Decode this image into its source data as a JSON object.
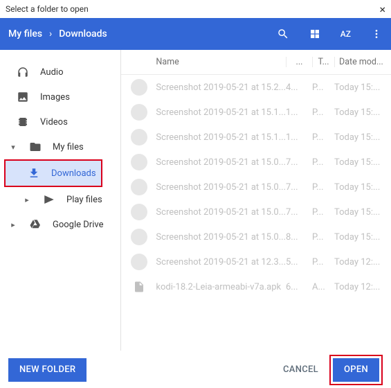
{
  "titlebar": {
    "title": "Select a folder to open"
  },
  "breadcrumb": {
    "root": "My files",
    "current": "Downloads"
  },
  "header": {
    "sort_label": "AZ"
  },
  "sidebar": {
    "audio": "Audio",
    "images": "Images",
    "videos": "Videos",
    "myfiles": "My files",
    "downloads": "Downloads",
    "playfiles": "Play files",
    "gdrive": "Google Drive"
  },
  "columns": {
    "name": "Name",
    "size": "...",
    "type": "T...",
    "date": "Date mod..."
  },
  "files": [
    {
      "name": "Screenshot 2019-05-21 at 15.2...",
      "size": "4...",
      "type": "P...",
      "date": "Today 15:..."
    },
    {
      "name": "Screenshot 2019-05-21 at 15.1...",
      "size": "1...",
      "type": "P...",
      "date": "Today 15:..."
    },
    {
      "name": "Screenshot 2019-05-21 at 15.1...",
      "size": "1...",
      "type": "P...",
      "date": "Today 15:..."
    },
    {
      "name": "Screenshot 2019-05-21 at 15.0...",
      "size": "7...",
      "type": "P...",
      "date": "Today 15:..."
    },
    {
      "name": "Screenshot 2019-05-21 at 15.0...",
      "size": "7...",
      "type": "P...",
      "date": "Today 15:..."
    },
    {
      "name": "Screenshot 2019-05-21 at 15.0...",
      "size": "7...",
      "type": "P...",
      "date": "Today 15:..."
    },
    {
      "name": "Screenshot 2019-05-21 at 15.0...",
      "size": "8...",
      "type": "P...",
      "date": "Today 15:..."
    },
    {
      "name": "Screenshot 2019-05-21 at 12.3...",
      "size": "5...",
      "type": "P...",
      "date": "Today 12:..."
    },
    {
      "name": "kodi-18.2-Leia-armeabi-v7a.apk",
      "size": "6...",
      "type": "A...",
      "date": "Today 12:...",
      "isfile": true
    }
  ],
  "footer": {
    "newfolder": "NEW FOLDER",
    "cancel": "CANCEL",
    "open": "OPEN"
  }
}
